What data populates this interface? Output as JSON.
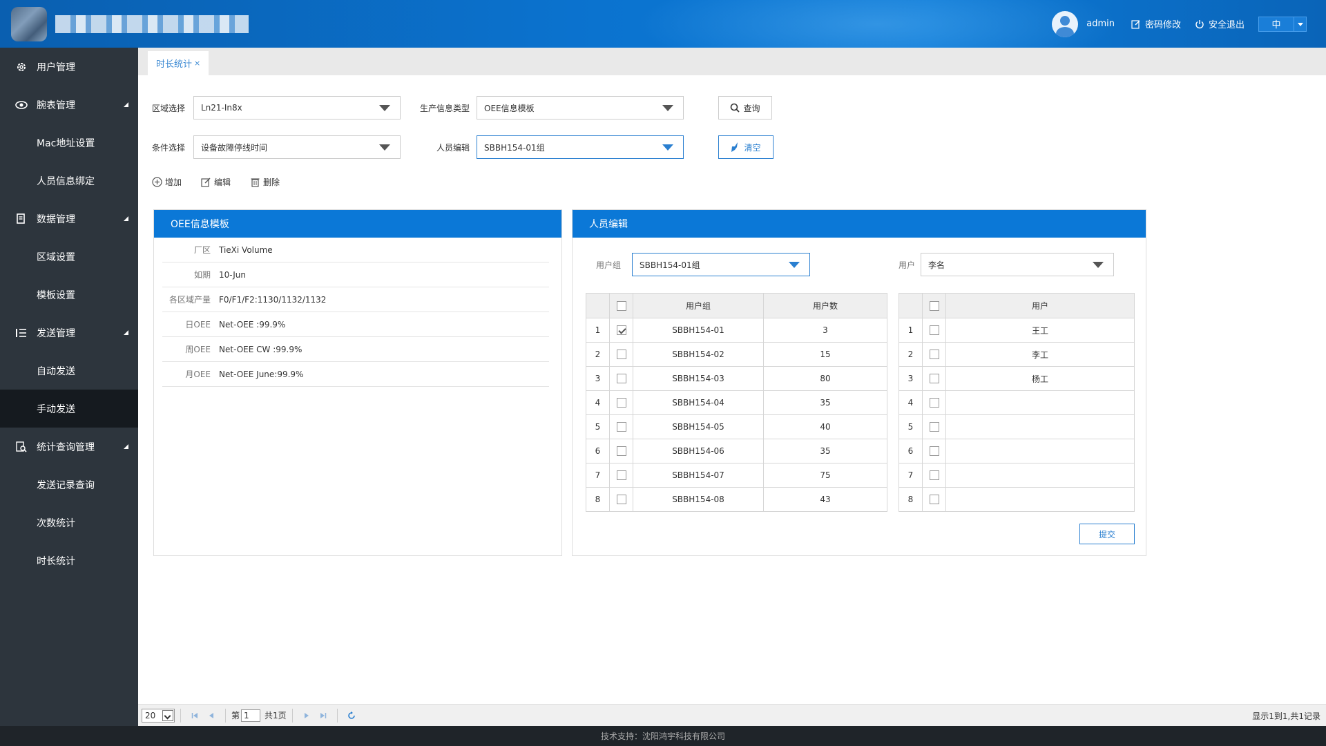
{
  "header": {
    "username": "admin",
    "change_password": "密码修改",
    "logout": "安全退出",
    "language": "中"
  },
  "sidebar": {
    "items": [
      {
        "label": "用户管理",
        "icon": "gear-icon",
        "level": "parent"
      },
      {
        "label": "腕表管理",
        "icon": "eye-icon",
        "level": "parent",
        "expanded": true
      },
      {
        "label": "Mac地址设置",
        "level": "child"
      },
      {
        "label": "人员信息绑定",
        "level": "child"
      },
      {
        "label": "数据管理",
        "icon": "document-icon",
        "level": "parent",
        "expanded": true
      },
      {
        "label": "区域设置",
        "level": "child"
      },
      {
        "label": "模板设置",
        "level": "child"
      },
      {
        "label": "发送管理",
        "icon": "list-icon",
        "level": "parent",
        "expanded": true
      },
      {
        "label": "自动发送",
        "level": "child"
      },
      {
        "label": "手动发送",
        "level": "child",
        "active": true
      },
      {
        "label": "统计查询管理",
        "icon": "search-doc-icon",
        "level": "parent",
        "expanded": true
      },
      {
        "label": "发送记录查询",
        "level": "child"
      },
      {
        "label": "次数统计",
        "level": "child"
      },
      {
        "label": "时长统计",
        "level": "child"
      }
    ]
  },
  "tabs": [
    {
      "label": "时长统计",
      "close": "×"
    }
  ],
  "filters": {
    "region_label": "区域选择",
    "region_value": "Ln21-In8x",
    "prod_type_label": "生产信息类型",
    "prod_type_value": "OEE信息模板",
    "query_button": "查询",
    "condition_label": "条件选择",
    "condition_value": "设备故障停线时间",
    "person_label": "人员编辑",
    "person_value": "SBBH154-01组",
    "clear_button": "清空"
  },
  "toolbar": {
    "add": "增加",
    "edit": "编辑",
    "delete": "删除"
  },
  "oee_panel": {
    "title": "OEE信息模板",
    "rows": [
      {
        "key": "厂区",
        "value": "TieXi Volume"
      },
      {
        "key": "如期",
        "value": "10-Jun"
      },
      {
        "key": "各区域产量",
        "value": "F0/F1/F2:1130/1132/1132"
      },
      {
        "key": "日OEE",
        "value": "Net-OEE :99.9%"
      },
      {
        "key": "周OEE",
        "value": "Net-OEE CW :99.9%"
      },
      {
        "key": "月OEE",
        "value": "Net-OEE June:99.9%"
      }
    ]
  },
  "person_panel": {
    "title": "人员编辑",
    "group_label": "用户组",
    "group_value": "SBBH154-01组",
    "user_label": "用户",
    "user_value": "李名",
    "group_table": {
      "headers": [
        "用户组",
        "用户数"
      ],
      "rows": [
        {
          "idx": "1",
          "checked": true,
          "group": "SBBH154-01",
          "count": "3"
        },
        {
          "idx": "2",
          "checked": false,
          "group": "SBBH154-02",
          "count": "15"
        },
        {
          "idx": "3",
          "checked": false,
          "group": "SBBH154-03",
          "count": "80"
        },
        {
          "idx": "4",
          "checked": false,
          "group": "SBBH154-04",
          "count": "35"
        },
        {
          "idx": "5",
          "checked": false,
          "group": "SBBH154-05",
          "count": "40"
        },
        {
          "idx": "6",
          "checked": false,
          "group": "SBBH154-06",
          "count": "35"
        },
        {
          "idx": "7",
          "checked": false,
          "group": "SBBH154-07",
          "count": "75"
        },
        {
          "idx": "8",
          "checked": false,
          "group": "SBBH154-08",
          "count": "43"
        }
      ]
    },
    "user_table": {
      "headers": [
        "用户"
      ],
      "rows": [
        {
          "idx": "1",
          "checked": false,
          "user": "王工"
        },
        {
          "idx": "2",
          "checked": false,
          "user": "李工"
        },
        {
          "idx": "3",
          "checked": false,
          "user": "杨工"
        },
        {
          "idx": "4",
          "checked": false,
          "user": ""
        },
        {
          "idx": "5",
          "checked": false,
          "user": ""
        },
        {
          "idx": "6",
          "checked": false,
          "user": ""
        },
        {
          "idx": "7",
          "checked": false,
          "user": ""
        },
        {
          "idx": "8",
          "checked": false,
          "user": ""
        }
      ]
    },
    "submit": "提交"
  },
  "pager": {
    "page_size": "20",
    "page_prefix": "第",
    "page_value": "1",
    "page_total": "共1页",
    "info": "显示1到1,共1记录"
  },
  "footer": {
    "text": "技术支持：沈阳鸿宇科技有限公司"
  },
  "colors": {
    "header_blue": "#0b73cf",
    "panel_blue": "#0b78d7",
    "sidebar_bg": "#2d353d",
    "sidebar_active": "#151a1f",
    "accent": "#2a7fd0"
  }
}
